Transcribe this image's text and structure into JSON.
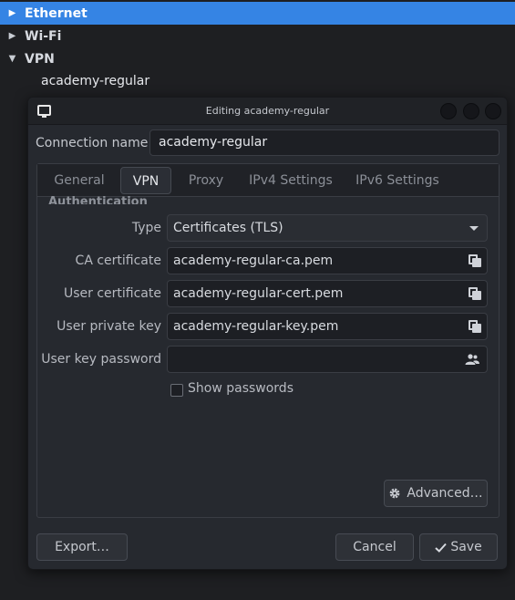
{
  "connections": {
    "groups": [
      {
        "label": "Ethernet",
        "icon": "triangle-right-icon",
        "selected": true
      },
      {
        "label": "Wi-Fi",
        "icon": "triangle-right-icon",
        "selected": false
      },
      {
        "label": "VPN",
        "icon": "triangle-down-icon",
        "selected": false
      }
    ],
    "vpn_child": "academy-regular"
  },
  "dialog": {
    "title": "Editing academy-regular",
    "connection_name_label": "Connection name",
    "connection_name_value": "academy-regular",
    "tabs": [
      "General",
      "VPN",
      "Proxy",
      "IPv4 Settings",
      "IPv6 Settings"
    ],
    "active_tab": "VPN",
    "section_heading": "Authentication",
    "fields": {
      "type": {
        "label": "Type",
        "value": "Certificates (TLS)"
      },
      "ca_certificate": {
        "label": "CA certificate",
        "value": "academy-regular-ca.pem"
      },
      "user_certificate": {
        "label": "User certificate",
        "value": "academy-regular-cert.pem"
      },
      "user_private_key": {
        "label": "User private key",
        "value": "academy-regular-key.pem"
      },
      "user_key_password": {
        "label": "User key password",
        "value": ""
      }
    },
    "show_passwords_label": "Show passwords",
    "show_passwords_checked": false,
    "advanced_label": "Advanced…",
    "export_label": "Export…",
    "cancel_label": "Cancel",
    "save_label": "Save"
  },
  "colors": {
    "accent": "#3584e4",
    "background": "#1e1f22",
    "dialog": "#26292f"
  }
}
